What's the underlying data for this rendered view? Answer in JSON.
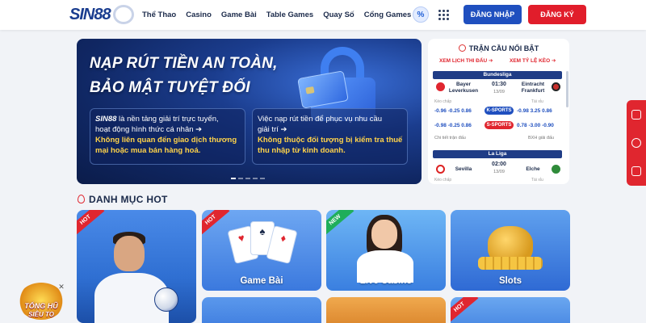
{
  "header": {
    "logo_text": "SIN",
    "logo_num": "88",
    "nav": [
      "Thể Thao",
      "Casino",
      "Game Bài",
      "Table Games",
      "Quay Số",
      "Cổng Games"
    ],
    "promo_symbol": "%",
    "login_label": "ĐĂNG NHẬP",
    "register_label": "ĐĂNG KÝ"
  },
  "banner": {
    "title_line1": "NẠP RÚT TIỀN AN TOÀN,",
    "title_line2": "BẢO MẬT TUYỆT ĐỐI",
    "left_brand": "SIN88",
    "left_line1_rest": " là nền tảng giải trí trực tuyến,",
    "left_line2": "hoạt động hình thức cá nhân ➔",
    "left_line3": "Không liên quan đến giao dịch thương",
    "left_line4": "mại hoặc mua bán hàng hoá.",
    "right_line1": "Việc nạp rút tiền để phục vụ nhu cầu",
    "right_line2": "giải trí ➔",
    "right_line3": "Không thuộc đối tượng bị kiểm tra thuế",
    "right_line4": "thu nhập từ kinh doanh.",
    "slide_count": 5,
    "active_slide": 1
  },
  "matches": {
    "title": "TRẬN CẦU NỔI BẬT",
    "link_schedule": "XEM LỊCH THI ĐẤU ➔",
    "link_odds": "XEM TỶ LỆ KÈO ➔",
    "league1": "Bundesliga",
    "match1": {
      "home_line1": "Bayer",
      "home_line2": "Leverkusen",
      "away_line1": "Eintracht",
      "away_line2": "Frankfurt",
      "time": "01:30",
      "date": "13/09",
      "label_left": "Kèo chấp",
      "label_right": "Tài xỉu",
      "row1_left": "-0.96  -0.25  0.86",
      "row1_right": "-0.98  3.25  0.86",
      "row2_left": "-0.98  -0.25  0.86",
      "row2_right": "0.78  -3.00  -0.90",
      "tag_k": "K-SPORTS",
      "tag_s": "S-SPORTS",
      "footer_left": "Chi tiết trận đấu",
      "footer_right": "BXH giải đấu"
    },
    "league2": "La Liga",
    "match2": {
      "home": "Sevilla",
      "away": "Elche",
      "time": "02:00",
      "date": "13/09",
      "label_left": "Kèo chấp",
      "label_right": "Tài xỉu"
    }
  },
  "section": {
    "title": "DANH MỤC HOT"
  },
  "games": {
    "sports_ribbon": "HOT",
    "game_bai_label": "Game Bài",
    "game_bai_ribbon": "HOT",
    "live_label": "Live Casino",
    "live_ribbon": "NEW",
    "slots_label": "Slots",
    "row2c_ribbon": "HOT"
  },
  "promo": {
    "line1": "TỔNG HŨ",
    "line2": "SIÊU TO",
    "close": "✕"
  }
}
